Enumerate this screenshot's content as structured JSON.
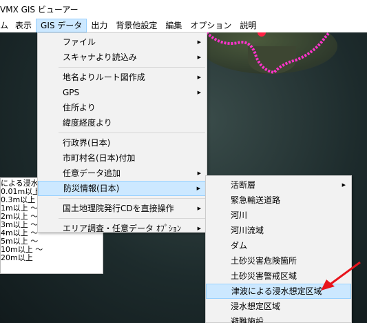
{
  "window": {
    "title": "VMX GIS ビューアー"
  },
  "menubar": {
    "items": [
      "ム",
      "表示",
      "GIS データ",
      "出力",
      "背景他設定",
      "編集",
      "オプション",
      "説明"
    ]
  },
  "gis_menu": {
    "items": [
      {
        "label": "ファイル",
        "submenu": true
      },
      {
        "label": "スキャナより読込み",
        "submenu": true
      },
      {
        "label": "地名よりルート図作成",
        "submenu": true
      },
      {
        "label": "GPS",
        "submenu": true
      },
      {
        "label": "住所より",
        "submenu": false
      },
      {
        "label": "緯度経度より",
        "submenu": false
      },
      {
        "label": "行政界(日本)",
        "submenu": false
      },
      {
        "label": "市町村名(日本)付加",
        "submenu": false
      },
      {
        "label": "任意データ追加",
        "submenu": true
      },
      {
        "label": "防災情報(日本)",
        "submenu": true
      },
      {
        "label": "国土地理院発行CDを直接操作",
        "submenu": true
      },
      {
        "label": "エリア調査・任意データ ｵﾌﾟｼｮﾝ",
        "submenu": true
      }
    ]
  },
  "bousai_menu": {
    "items": [
      {
        "label": "活断層",
        "submenu": true
      },
      {
        "label": "緊急輸送道路",
        "submenu": false
      },
      {
        "label": "河川",
        "submenu": false
      },
      {
        "label": "河川流域",
        "submenu": false
      },
      {
        "label": "ダム",
        "submenu": false
      },
      {
        "label": "土砂災害危険箇所",
        "submenu": false
      },
      {
        "label": "土砂災害警戒区域",
        "submenu": false
      },
      {
        "label": "津波による浸水想定区域",
        "submenu": false
      },
      {
        "label": "浸水想定区域",
        "submenu": false
      },
      {
        "label": "避難施設",
        "submenu": false
      }
    ]
  },
  "legend": {
    "rows": [
      "による浸水",
      "0.01m以上",
      "0.3m以上 ～",
      "1m以上 ～",
      "2m以上 ～",
      "3m以上 ～",
      "4m以上 ～",
      "5m以上 ～",
      "10m以上 ～",
      "20m以上"
    ]
  },
  "colors": {
    "highlight": "#cce8ff",
    "highlight_border": "#99d1ff",
    "coast": "#ff33cc",
    "arrow": "#e8141c"
  }
}
